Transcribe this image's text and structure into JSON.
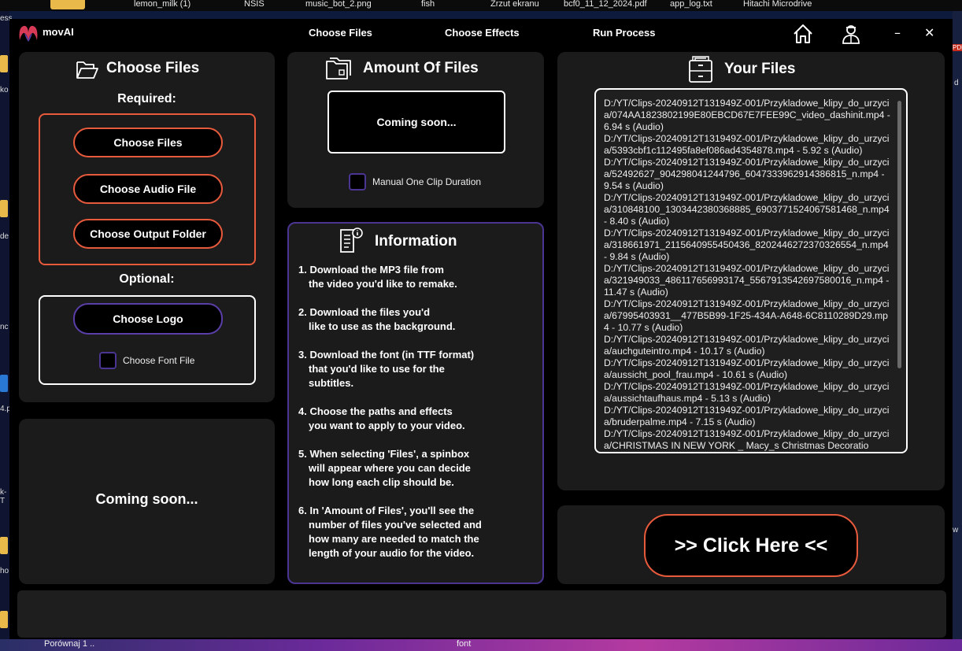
{
  "desktop": {
    "top_labels": [
      "lemon_milk (1)",
      "NSIS",
      "music_bot_2.png",
      "fish",
      "Zrzut ekranu",
      "bcf0_11_12_2024.pdf",
      "app_log.txt",
      "Hitachi Microdrive"
    ],
    "left_fragments": [
      "ess",
      "ko",
      "de",
      "nc",
      "4.p",
      "k-T",
      "ho"
    ],
    "right_fragments": [
      "PDF",
      "d",
      "w"
    ],
    "bottom_labels": [
      "Porównaj 1 ..",
      "font"
    ]
  },
  "titlebar": {
    "app_name": "movAI",
    "nav": [
      "Choose Files",
      "Choose Effects",
      "Run Process"
    ],
    "home_icon": "home-icon",
    "user_icon": "user-icon",
    "minimize": "–",
    "close": "✕"
  },
  "choose_files": {
    "title": "Choose Files",
    "required_label": "Required:",
    "buttons": [
      "Choose Files",
      "Choose Audio File",
      "Choose Output Folder"
    ],
    "optional_label": "Optional:",
    "logo_button": "Choose Logo",
    "font_checkbox": "Choose Font File"
  },
  "left_bottom": {
    "text": "Coming soon..."
  },
  "amount": {
    "title": "Amount Of Files",
    "box_text": "Coming soon...",
    "checkbox": "Manual One Clip Duration"
  },
  "information": {
    "title": "Information",
    "steps": [
      [
        "1. Download the MP3 file from",
        "the video you'd like to remake."
      ],
      [
        "2. Download the files you'd",
        "like to use as the background."
      ],
      [
        "3. Download the font (in TTF format)",
        "that you'd like to use for the",
        "subtitles."
      ],
      [
        "4. Choose the paths and effects",
        "you want to apply to your video."
      ],
      [
        "5. When selecting 'Files', a spinbox",
        "will appear where you can decide",
        "how long each clip should be."
      ],
      [
        "6. In 'Amount of Files', you'll see the",
        "number of files you've selected and",
        "how many are needed to match the",
        "length of your audio for the video."
      ]
    ]
  },
  "your_files": {
    "title": "Your Files",
    "entries": [
      "D:/YT/Clips-20240912T131949Z-001/Przykladowe_klipy_do_urzycia/074AA1823802199E80EBCD67E7FEE99C_video_dashinit.mp4 - 6.94 s (Audio)",
      "D:/YT/Clips-20240912T131949Z-001/Przykladowe_klipy_do_urzycia/5393cbf1c112495fa8ef086ad4354878.mp4 - 5.92 s (Audio)",
      "D:/YT/Clips-20240912T131949Z-001/Przykladowe_klipy_do_urzycia/52492627_904298041244796_6047333962914386815_n.mp4 - 9.54 s (Audio)",
      "D:/YT/Clips-20240912T131949Z-001/Przykladowe_klipy_do_urzycia/310848100_1303442380368885_6903771524067581468_n.mp4 - 8.40 s (Audio)",
      "D:/YT/Clips-20240912T131949Z-001/Przykladowe_klipy_do_urzycia/318661971_2115640955450436_8202446272370326554_n.mp4 - 9.84 s (Audio)",
      "D:/YT/Clips-20240912T131949Z-001/Przykladowe_klipy_do_urzycia/321949033_486117656993174_5567913542697580016_n.mp4 - 11.47 s (Audio)",
      "D:/YT/Clips-20240912T131949Z-001/Przykladowe_klipy_do_urzycia/67995403931__477B5B99-1F25-434A-A648-6C8110289D29.mp4 - 10.77 s (Audio)",
      "D:/YT/Clips-20240912T131949Z-001/Przykladowe_klipy_do_urzycia/auchguteintro.mp4 - 10.17 s (Audio)",
      "D:/YT/Clips-20240912T131949Z-001/Przykladowe_klipy_do_urzycia/aussicht_pool_frau.mp4 - 10.61 s (Audio)",
      "D:/YT/Clips-20240912T131949Z-001/Przykladowe_klipy_do_urzycia/aussichtaufhaus.mp4 - 5.13 s (Audio)",
      "D:/YT/Clips-20240912T131949Z-001/Przykladowe_klipy_do_urzycia/bruderpalme.mp4 - 7.15 s (Audio)",
      "D:/YT/Clips-20240912T131949Z-001/Przykladowe_klipy_do_urzycia/CHRISTMAS IN NEW YORK _ Macy_s Christmas Decoratio"
    ]
  },
  "run": {
    "button": ">> Click Here <<"
  },
  "colors": {
    "accent_red": "#e85a3c",
    "accent_purple": "#5a3fa8",
    "panel": "#1b1b1b"
  }
}
